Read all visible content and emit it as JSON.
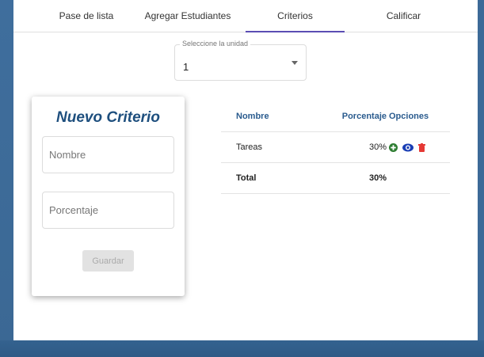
{
  "tabs": [
    {
      "label": "Pase de lista"
    },
    {
      "label": "Agregar Estudiantes"
    },
    {
      "label": "Criterios"
    },
    {
      "label": "Calificar"
    }
  ],
  "unit_select": {
    "label": "Seleccione la unidad",
    "value": "1"
  },
  "form": {
    "title": "Nuevo Criterio",
    "name_placeholder": "Nombre",
    "percent_placeholder": "Porcentaje",
    "save_label": "Guardar"
  },
  "table": {
    "headers": {
      "name": "Nombre",
      "percent": "Porcentaje",
      "options": "Opciones"
    },
    "rows": [
      {
        "name": "Tareas",
        "percent": "30%",
        "actions": [
          "add-icon",
          "eye-icon",
          "trash-icon"
        ]
      }
    ],
    "total": {
      "label": "Total",
      "percent": "30%"
    }
  },
  "colors": {
    "accent": "#5b4db3",
    "header_text": "#2a5b8e",
    "add": "#2e7d32",
    "view": "#1a3fb5",
    "delete": "#e53935"
  }
}
